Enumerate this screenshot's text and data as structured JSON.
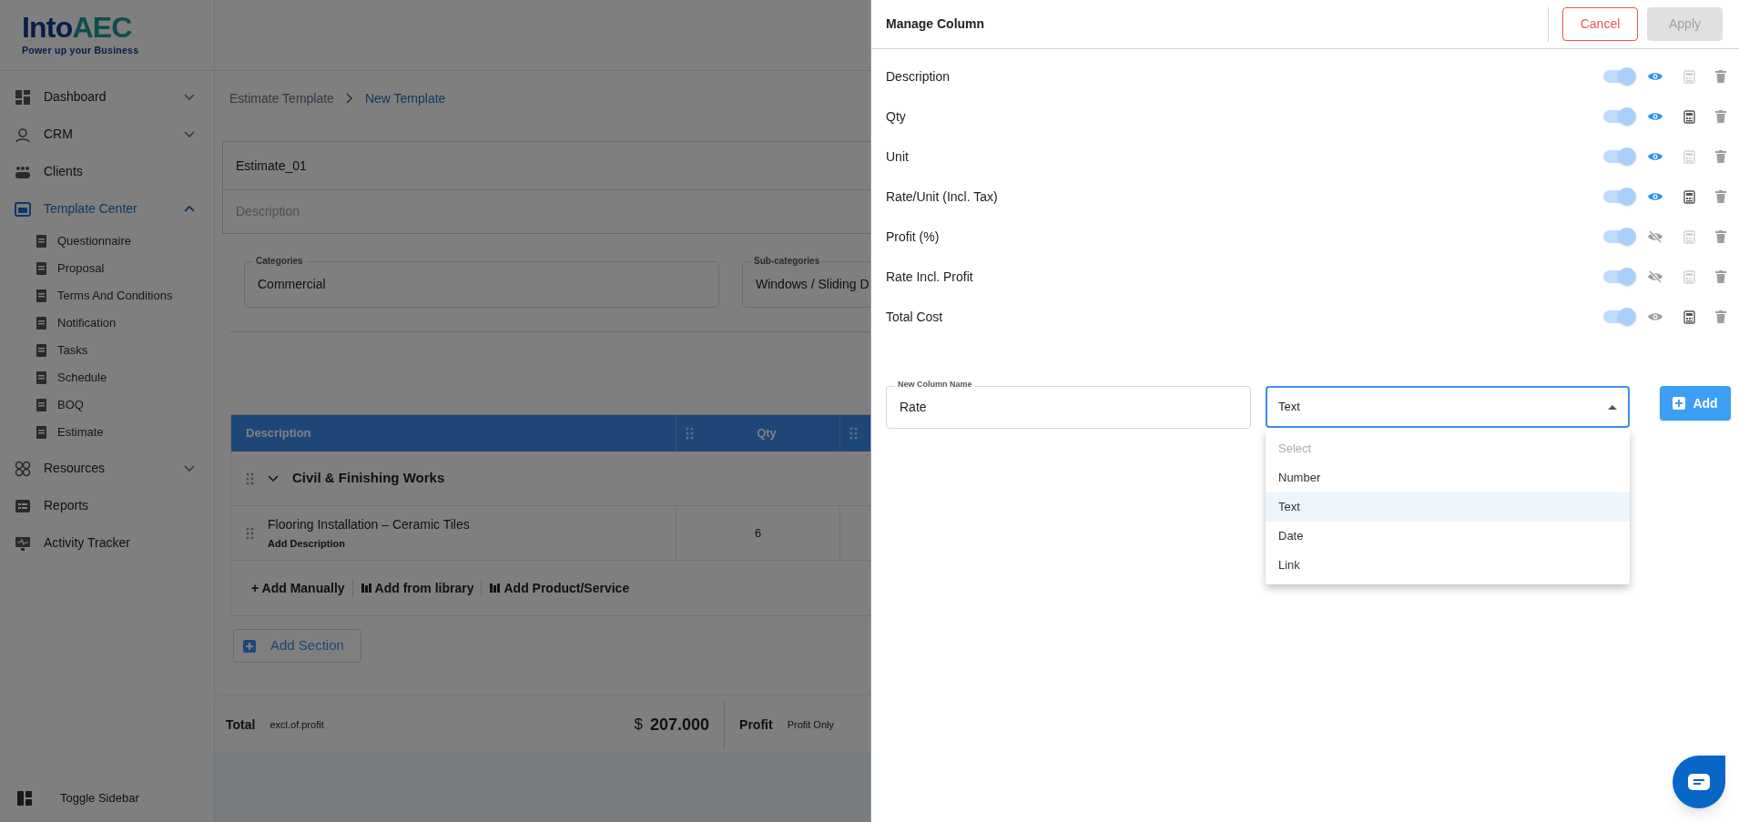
{
  "sidebar": {
    "logo": {
      "primary": "Into",
      "secondary": "AEC",
      "tagline": "Power up your Business"
    },
    "items": [
      {
        "label": "Dashboard",
        "selected": false,
        "expanded": false
      },
      {
        "label": "CRM",
        "selected": false,
        "expanded": false
      },
      {
        "label": "Clients",
        "selected": false
      },
      {
        "label": "Template Center",
        "selected": true,
        "expanded": true,
        "children": [
          {
            "label": "Questionnaire"
          },
          {
            "label": "Proposal"
          },
          {
            "label": "Terms And Conditions"
          },
          {
            "label": "Notification"
          },
          {
            "label": "Tasks"
          },
          {
            "label": "Schedule"
          },
          {
            "label": "BOQ"
          },
          {
            "label": "Estimate"
          }
        ]
      },
      {
        "label": "Resources",
        "selected": false,
        "expanded": false
      },
      {
        "label": "Reports",
        "selected": false
      },
      {
        "label": "Activity Tracker",
        "selected": false
      }
    ],
    "toggle": "Toggle Sidebar"
  },
  "breadcrumb": [
    "Estimate Template",
    "New Template"
  ],
  "template": {
    "name": "Estimate_01",
    "description_placeholder": "Description"
  },
  "categories": [
    {
      "label": "Categories",
      "value": "Commercial"
    },
    {
      "label": "Sub-categories",
      "value": "Windows / Sliding D"
    }
  ],
  "table": {
    "columns": [
      "Description",
      "Qty"
    ],
    "sections": [
      {
        "title": "Civil & Finishing Works",
        "expanded": true,
        "rows": [
          {
            "description": "Flooring Installation – Ceramic Tiles",
            "note": "Add Description",
            "qty": "6"
          }
        ]
      }
    ],
    "actions": [
      "+ Add Manually",
      "Add from library",
      "Add Product/Service"
    ]
  },
  "add_section": "Add Section",
  "totals": {
    "label": "Total",
    "note": "excl.of.profit",
    "currency": "$",
    "amount": "207.000",
    "profit_label": "Profit",
    "profit_note": "Profit Only"
  },
  "panel": {
    "title": "Manage Column",
    "buttons": [
      {
        "label": "Cancel",
        "disabled": false
      },
      {
        "label": "Apply",
        "disabled": true
      }
    ],
    "columns": [
      {
        "name": "Description",
        "enabled": true,
        "visible": true,
        "highlighted": true,
        "formula": false
      },
      {
        "name": "Qty",
        "enabled": true,
        "visible": true,
        "highlighted": true,
        "formula": true
      },
      {
        "name": "Unit",
        "enabled": true,
        "visible": true,
        "highlighted": true,
        "formula": false
      },
      {
        "name": "Rate/Unit (Incl. Tax)",
        "enabled": true,
        "visible": true,
        "highlighted": true,
        "formula": true
      },
      {
        "name": "Profit (%)",
        "enabled": true,
        "visible": false,
        "highlighted": false,
        "formula": false
      },
      {
        "name": "Rate Incl. Profit",
        "enabled": true,
        "visible": false,
        "highlighted": false,
        "formula": false
      },
      {
        "name": "Total Cost",
        "enabled": true,
        "visible": true,
        "highlighted": false,
        "formula": true
      }
    ],
    "new_column": {
      "label": "New Column Name",
      "value": "Rate"
    },
    "type_select": {
      "value": "Text",
      "expanded": true,
      "options": [
        {
          "label": "Select",
          "selected": false,
          "disabled": true
        },
        {
          "label": "Number",
          "selected": false,
          "disabled": false
        },
        {
          "label": "Text",
          "selected": true,
          "disabled": false
        },
        {
          "label": "Date",
          "selected": false,
          "disabled": false
        },
        {
          "label": "Link",
          "selected": false,
          "disabled": false
        }
      ]
    },
    "add_button": "Add"
  }
}
